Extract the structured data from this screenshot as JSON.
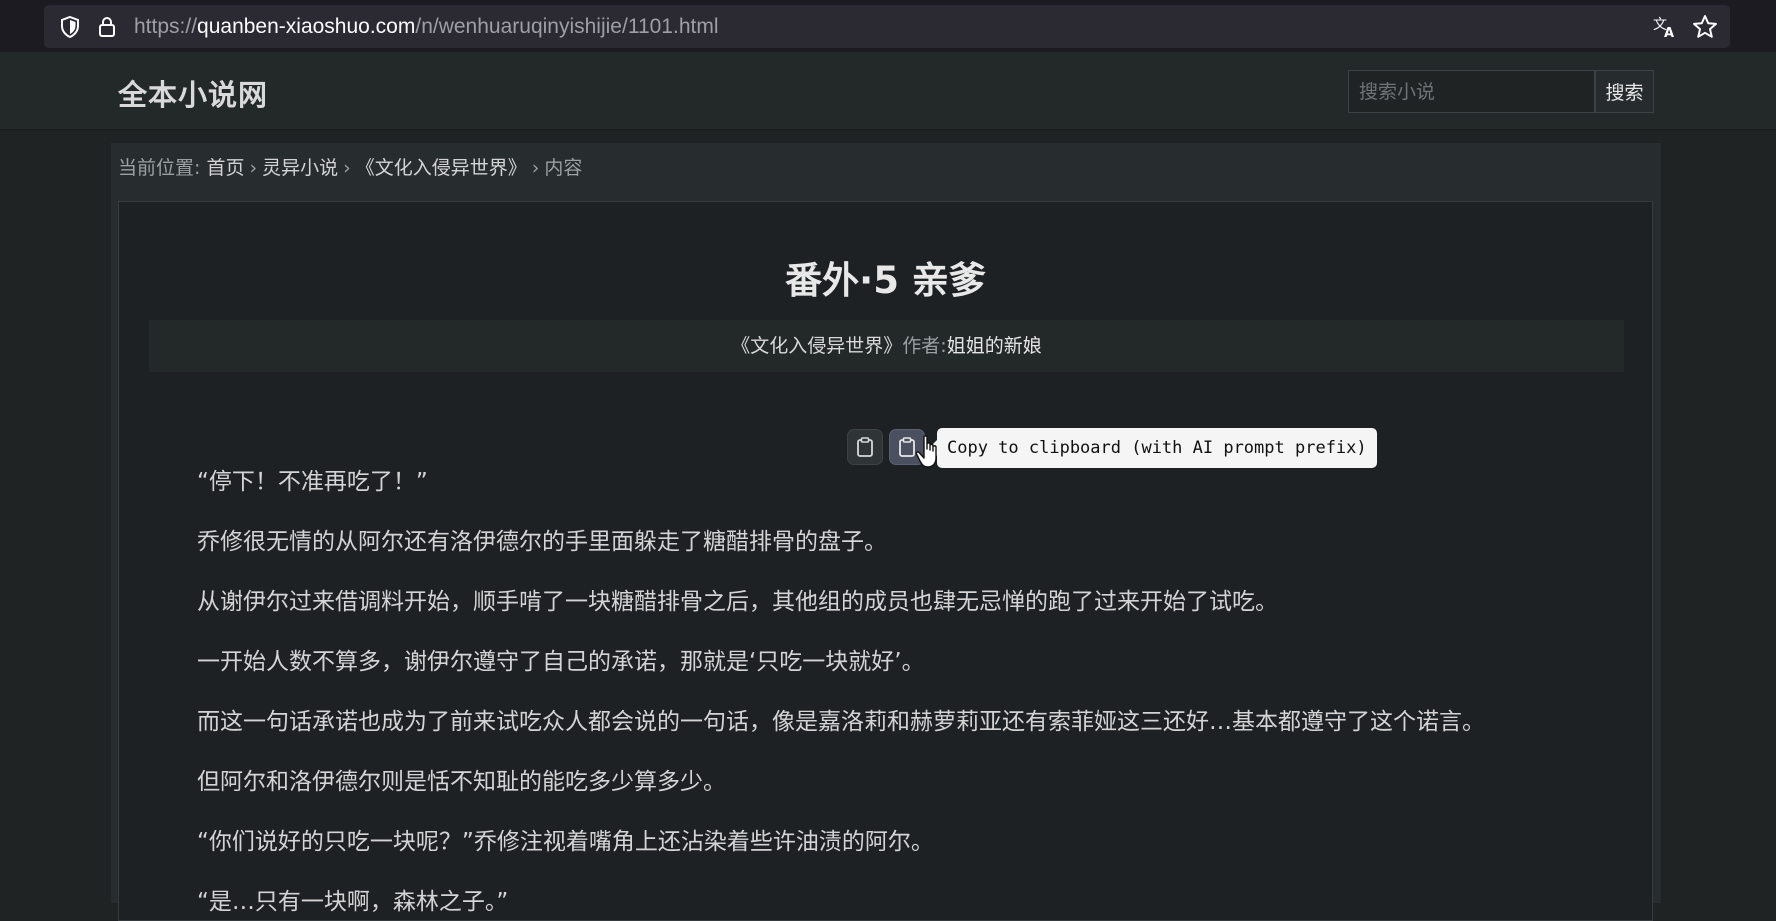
{
  "browser": {
    "url_prefix": "https://",
    "url_host": "quanben-xiaoshuo.com",
    "url_path": "/n/wenhuaruqinyishijie/1101.html",
    "icons": [
      "shield-icon",
      "lock-icon",
      "translate-icon",
      "bookmark-star-icon"
    ]
  },
  "header": {
    "logo": "全本小说网",
    "search_placeholder": "搜索小说",
    "search_label": "搜索"
  },
  "breadcrumb": {
    "prefix": "当前位置:",
    "home": "首页",
    "category": "灵异小说",
    "book": "《文化入侵异世界》",
    "current": "内容",
    "separator": "›"
  },
  "chapter": {
    "title": "番外·5 亲爹",
    "book_name": "《文化入侵异世界》",
    "author_label": "作者:",
    "author": "姐姐的新娘"
  },
  "tooltip": {
    "text": "Copy to clipboard (with AI prompt prefix)"
  },
  "paragraphs": [
    "“停下！不准再吃了！”",
    "乔修很无情的从阿尔还有洛伊德尔的手里面躲走了糖醋排骨的盘子。",
    "从谢伊尔过来借调料开始，顺手啃了一块糖醋排骨之后，其他组的成员也肆无忌惮的跑了过来开始了试吃。",
    "一开始人数不算多，谢伊尔遵守了自己的承诺，那就是‘只吃一块就好’。",
    "而这一句话承诺也成为了前来试吃众人都会说的一句话，像是嘉洛莉和赫萝莉亚还有索菲娅这三还好…基本都遵守了这个诺言。",
    "但阿尔和洛伊德尔则是恬不知耻的能吃多少算多少。",
    "“你们说好的只吃一块呢？”乔修注视着嘴角上还沾染着些许油渍的阿尔。",
    "“是…只有一块啊，森林之子。”"
  ]
}
